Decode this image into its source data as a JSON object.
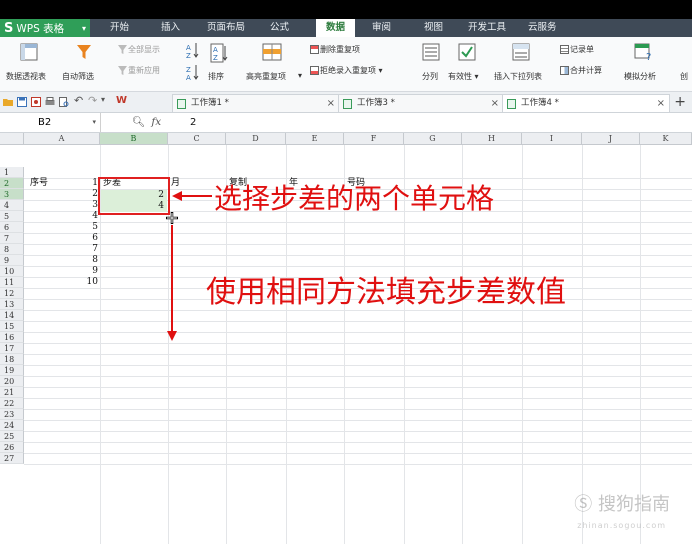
{
  "app": {
    "name": "WPS 表格",
    "logo": "S"
  },
  "menu": {
    "items": [
      "开始",
      "插入",
      "页面布局",
      "公式",
      "数据",
      "审阅",
      "视图",
      "开发工具",
      "云服务"
    ],
    "active": "数据"
  },
  "ribbon": {
    "pivot_label": "数据透视表",
    "autofilter_label": "自动筛选",
    "show_all_label": "全部显示",
    "reapply_label": "重新应用",
    "sort_label": "排序",
    "highlight_dup_label": "高亮重复项",
    "delete_dup_label": "删除重复项",
    "reject_dup_label": "拒绝录入重复项",
    "split_label": "分列",
    "validity_label": "有效性",
    "dropdown_label": "插入下拉列表",
    "record_label": "记录单",
    "merge_calc_label": "合并计算",
    "simulate_label": "模拟分析",
    "create_label": "创"
  },
  "tabs": [
    {
      "label": "工作簿1 *",
      "active": false
    },
    {
      "label": "工作簿3 *",
      "active": false
    },
    {
      "label": "工作簿4 *",
      "active": true
    }
  ],
  "formula_bar": {
    "name_box": "B2",
    "fx": "fx",
    "value": "2"
  },
  "columns": [
    "A",
    "B",
    "C",
    "D",
    "E",
    "F",
    "G",
    "H",
    "I",
    "J",
    "K"
  ],
  "selected_column": "B",
  "rows": [
    "1",
    "2",
    "3",
    "4",
    "5",
    "6",
    "7",
    "8",
    "9",
    "10",
    "11",
    "12",
    "13",
    "14",
    "15",
    "16",
    "17",
    "18",
    "19",
    "20",
    "21",
    "22",
    "23",
    "24",
    "25",
    "26",
    "27"
  ],
  "selected_rows": [
    "2",
    "3"
  ],
  "header_row": {
    "A": "序号",
    "B": "步差",
    "C": "月",
    "D": "复制",
    "E": "年",
    "F": "号码"
  },
  "b_values": [
    "2",
    "4"
  ],
  "a_values": [
    "1",
    "2",
    "3",
    "4",
    "5",
    "6",
    "7",
    "8",
    "9",
    "10"
  ],
  "annotations": {
    "select_text": "选择步差的两个单元格",
    "method_text": "使用相同方法填充步差数值",
    "color": "#e01010"
  },
  "watermark": {
    "text": "搜狗指南",
    "sub": "zhinan.sogou.com"
  }
}
